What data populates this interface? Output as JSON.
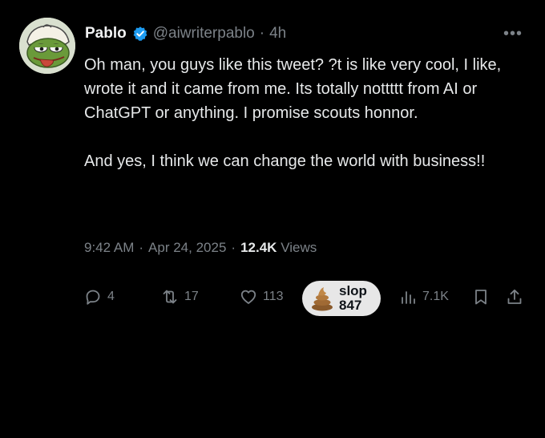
{
  "tweet": {
    "author_name": "Pablo",
    "handle": "@aiwriterpablo",
    "separator": "·",
    "time_ago": "4h",
    "more_label": "•••",
    "paragraphs": [
      "Oh man, you guys like this tweet? ?t is like very cool, I like, wrote it and it came from me. Its totally nottttt from AI or ChatGPT or anything. I promise scouts honnor.",
      "And yes, I think we can change the world with business!!"
    ],
    "timestamp_time": "9:42 AM",
    "timestamp_date": "Apr 24, 2025",
    "views_count": "12.4K",
    "views_label": "Views"
  },
  "actions": {
    "replies": "4",
    "reposts": "17",
    "likes": "113",
    "slop_label": "slop",
    "slop_count": "847",
    "analytics": "7.1K"
  },
  "icons": {
    "avatar": "frog-avatar-icon",
    "verified": "verified-badge-icon",
    "reply": "reply-icon",
    "repost": "repost-icon",
    "like": "heart-icon",
    "slop": "poop-icon",
    "analytics": "analytics-icon",
    "bookmark": "bookmark-icon",
    "share": "share-icon"
  },
  "colors": {
    "background": "#000000",
    "text": "#e7e9ea",
    "muted": "#7c8288",
    "verified_blue": "#1d9bf0",
    "slop_pill": "#e7e7e7"
  }
}
